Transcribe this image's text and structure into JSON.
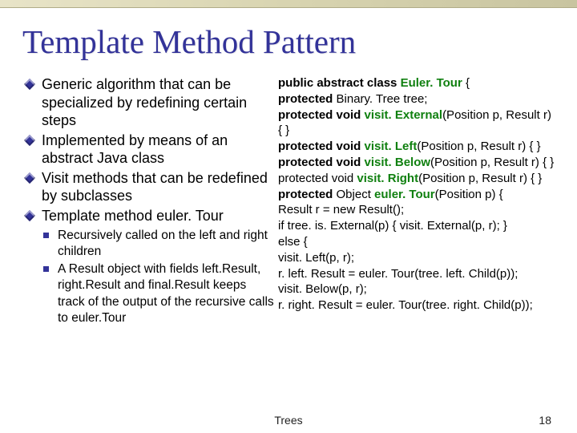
{
  "title": "Template Method Pattern",
  "left_bullets": [
    "Generic algorithm that can be specialized by redefining certain steps",
    "Implemented by means of an abstract Java class",
    "Visit methods that can be redefined by subclasses",
    "Template method euler. Tour"
  ],
  "sub_bullets": [
    "Recursively called on the left and right children",
    "A Result object with fields left.Result, right.Result and final.Result keeps track of the output of the recursive calls to euler.Tour"
  ],
  "code": {
    "ln1a": "public abstract class ",
    "ln1b": "Euler. Tour",
    "ln1c": " {",
    "ln2a": "    protected ",
    "ln2b": "Binary. Tree tree;",
    "ln3a": "    protected void ",
    "ln3b": "visit. External",
    "ln3c": "(Position p, Result r) { }",
    "ln4a": "    protected void ",
    "ln4b": "visit. Left",
    "ln4c": "(Position p, Result r) { }",
    "ln5a": "    protected void ",
    "ln5b": "visit. Below",
    "ln5c": "(Position p, Result r) { }    protected void ",
    "ln5d": "visit. Right",
    "ln5e": "(Position p, Result r) { }",
    "ln6a": "    protected ",
    "ln6b": "Object ",
    "ln6c": "euler. Tour",
    "ln6d": "(Position p) {",
    "ln7": "        Result r = new Result();",
    "ln8": "        if tree. is. External(p) { visit. External(p, r); }",
    "ln9": "        else {",
    "ln10": "            visit. Left(p, r);",
    "ln11": "            r. left. Result = euler. Tour(tree. left. Child(p));",
    "ln12": "            visit. Below(p, r);",
    "ln13": "            r. right. Result = euler. Tour(tree. right. Child(p));"
  },
  "footer": {
    "label": "Trees",
    "page": "18"
  }
}
